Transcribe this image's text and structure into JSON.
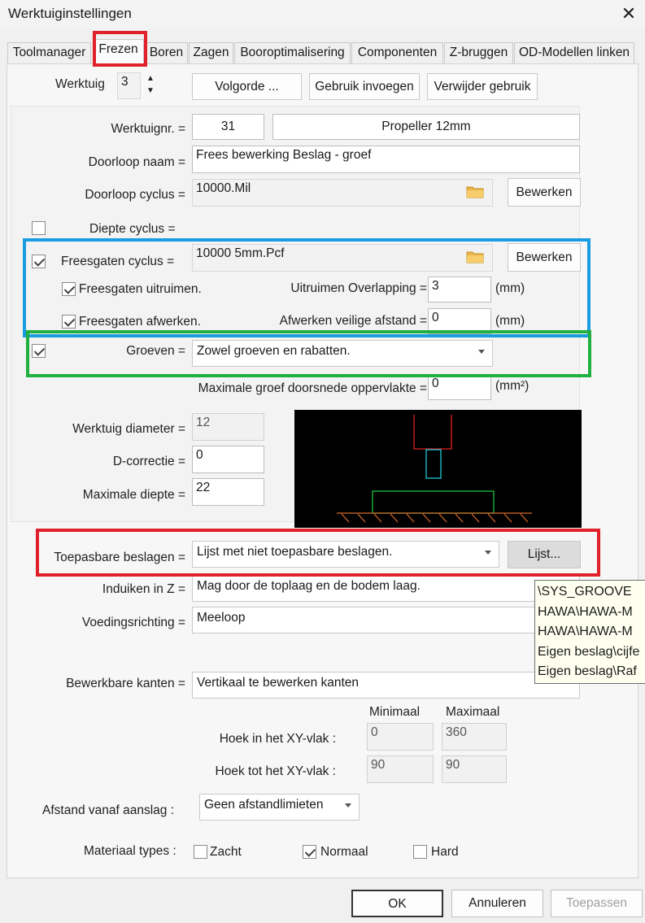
{
  "window": {
    "title": "Werktuiginstellingen",
    "close_icon": "close-icon"
  },
  "tabs": [
    "Toolmanager",
    "Frezen",
    "Boren",
    "Zagen",
    "Booroptimalisering",
    "Componenten",
    "Z-bruggen",
    "OD-Modellen linken"
  ],
  "active_tab": "Frezen",
  "toolbar": {
    "werktuig_label": "Werktuig",
    "werktuig_value": "3",
    "volgorde": "Volgorde ...",
    "gebruik_invoegen": "Gebruik invoegen",
    "verwijder_gebruik": "Verwijder gebruik"
  },
  "form": {
    "werktuignr_label": "Werktuignr. =",
    "werktuignr": "31",
    "werktuig_naam": "Propeller 12mm",
    "doorloop_naam_label": "Doorloop naam =",
    "doorloop_naam": "Frees bewerking Beslag - groef",
    "doorloop_cyclus_label": "Doorloop cyclus =",
    "doorloop_cyclus": "10000.Mil",
    "bewerken": "Bewerken",
    "diepte_cyclus_label": "Diepte cyclus =",
    "diepte_cyclus_checked": false,
    "freesgaten_cyclus_label": "Freesgaten cyclus =",
    "freesgaten_cyclus_checked": true,
    "freesgaten_cyclus": "10000 5mm.Pcf",
    "uitruimen_label": "Freesgaten uitruimen.",
    "uitruimen_checked": true,
    "afwerken_label": "Freesgaten afwerken.",
    "afwerken_checked": true,
    "overlapping_label": "Uitruimen Overlapping =",
    "overlapping": "3",
    "veilige_afstand_label": "Afwerken veilige afstand =",
    "veilige_afstand": "0",
    "unit_mm": "(mm)",
    "groeven_label": "Groeven =",
    "groeven_checked": true,
    "groeven": "Zowel groeven en rabatten.",
    "max_groef_label": "Maximale groef doorsnede oppervlakte =",
    "max_groef": "0",
    "unit_mm2": "(mm²)",
    "diameter_label": "Werktuig diameter =",
    "diameter": "12",
    "dcorrectie_label": "D-correctie =",
    "dcorrectie": "0",
    "max_diepte_label": "Maximale diepte =",
    "max_diepte": "22",
    "toepasbare_label": "Toepasbare beslagen =",
    "toepasbare": "Lijst met niet toepasbare beslagen.",
    "lijst": "Lijst...",
    "induiken_label": "Induiken in Z =",
    "induiken": "Mag door de toplaag en de bodem laag.",
    "voeding_label": "Voedingsrichting =",
    "voeding": "Meeloop",
    "kanten_label": "Bewerkbare kanten =",
    "kanten": "Vertikaal te bewerken kanten",
    "minimaal": "Minimaal",
    "maximaal": "Maximaal",
    "hoek_xy_label": "Hoek in het XY-vlak :",
    "hoek_xy_min": "0",
    "hoek_xy_max": "360",
    "hoek_tot_label": "Hoek tot het  XY-vlak :",
    "hoek_tot_min": "90",
    "hoek_tot_max": "90",
    "afstand_label": "Afstand vanaf aanslag :",
    "afstand": "Geen afstandlimieten",
    "materiaal_label": "Materiaal types :",
    "zacht": "Zacht",
    "zacht_checked": false,
    "normaal": "Normaal",
    "normaal_checked": true,
    "hard": "Hard",
    "hard_checked": false
  },
  "tooltip": [
    "\\SYS_GROOVE",
    "HAWA\\HAWA-M",
    "HAWA\\HAWA-M",
    "Eigen beslag\\cijfe",
    "Eigen beslag\\Raf"
  ],
  "footer": {
    "ok": "OK",
    "annuleren": "Annuleren",
    "toepassen": "Toepassen"
  },
  "colors": {
    "highlight_red": "#e0202a",
    "highlight_blue": "#1a9ce0",
    "highlight_green": "#20b040",
    "preview_bg": "#000000"
  }
}
